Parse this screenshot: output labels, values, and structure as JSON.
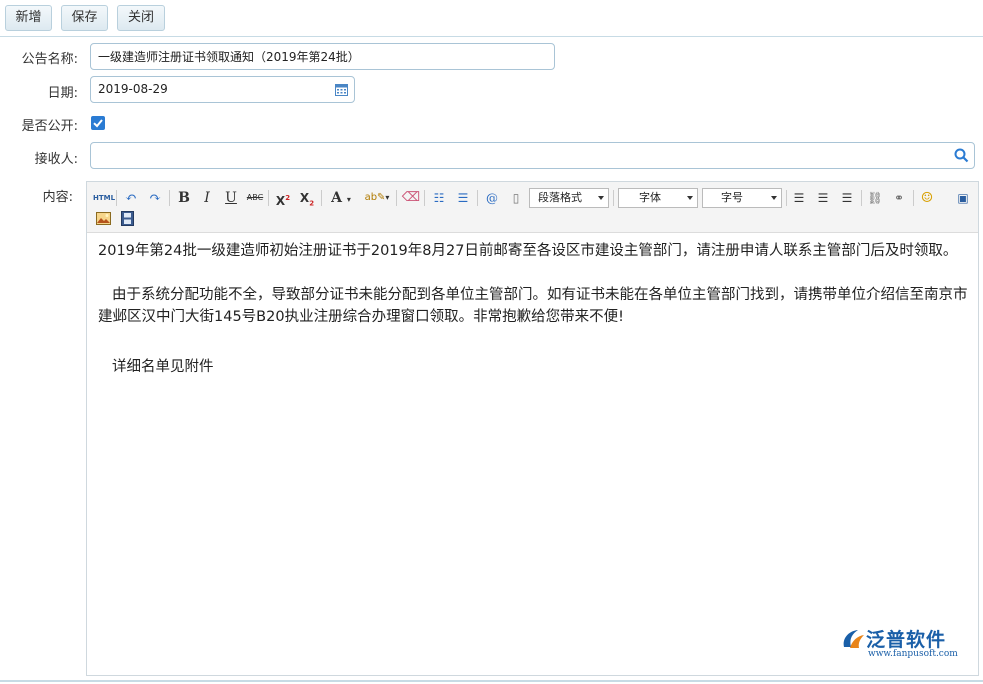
{
  "toolbar": {
    "new_label": "新增",
    "save_label": "保存",
    "close_label": "关闭"
  },
  "form": {
    "title_label": "公告名称:",
    "title_value": "一级建造师注册证书领取通知（2019年第24批）",
    "date_label": "日期:",
    "date_value": "2019-08-29",
    "public_label": "是否公开:",
    "public_checked": true,
    "recipient_label": "接收人:",
    "recipient_value": "",
    "content_label": "内容:"
  },
  "editor": {
    "toolbar_icons": [
      "html-icon",
      "undo-icon",
      "redo-icon",
      "bold-icon",
      "italic-icon",
      "underline-icon",
      "strikethrough-icon",
      "superscript-icon",
      "subscript-icon",
      "font-color-icon",
      "highlight-color-icon",
      "eraser-icon",
      "ordered-list-icon",
      "unordered-list-icon",
      "anchor-icon",
      "template-icon",
      "link-icon",
      "unlink-icon",
      "emoticon-icon",
      "fullscreen-icon",
      "image-icon",
      "video-icon"
    ],
    "paragraph_format": "段落格式",
    "font_family": "字体",
    "font_size": "字号",
    "paragraphs": [
      "2019年第24批一级建造师初始注册证书于2019年8月27日前邮寄至各设区市建设主管部门，请注册申请人联系主管部门后及时领取。",
      "由于系统分配功能不全，导致部分证书未能分配到各单位主管部门。如有证书未能在各单位主管部门找到，请携带单位介绍信至南京市建邺区汉中门大街145号B20执业注册综合办理窗口领取。非常抱歉给您带来不便!",
      "详细名单见附件"
    ]
  },
  "logo": {
    "brand": "泛普软件",
    "url": "www.fanpusoft.com"
  },
  "colors": {
    "accent": "#2a7bd3",
    "border": "#a9c4d6",
    "logo_blue": "#1a5fa8"
  }
}
